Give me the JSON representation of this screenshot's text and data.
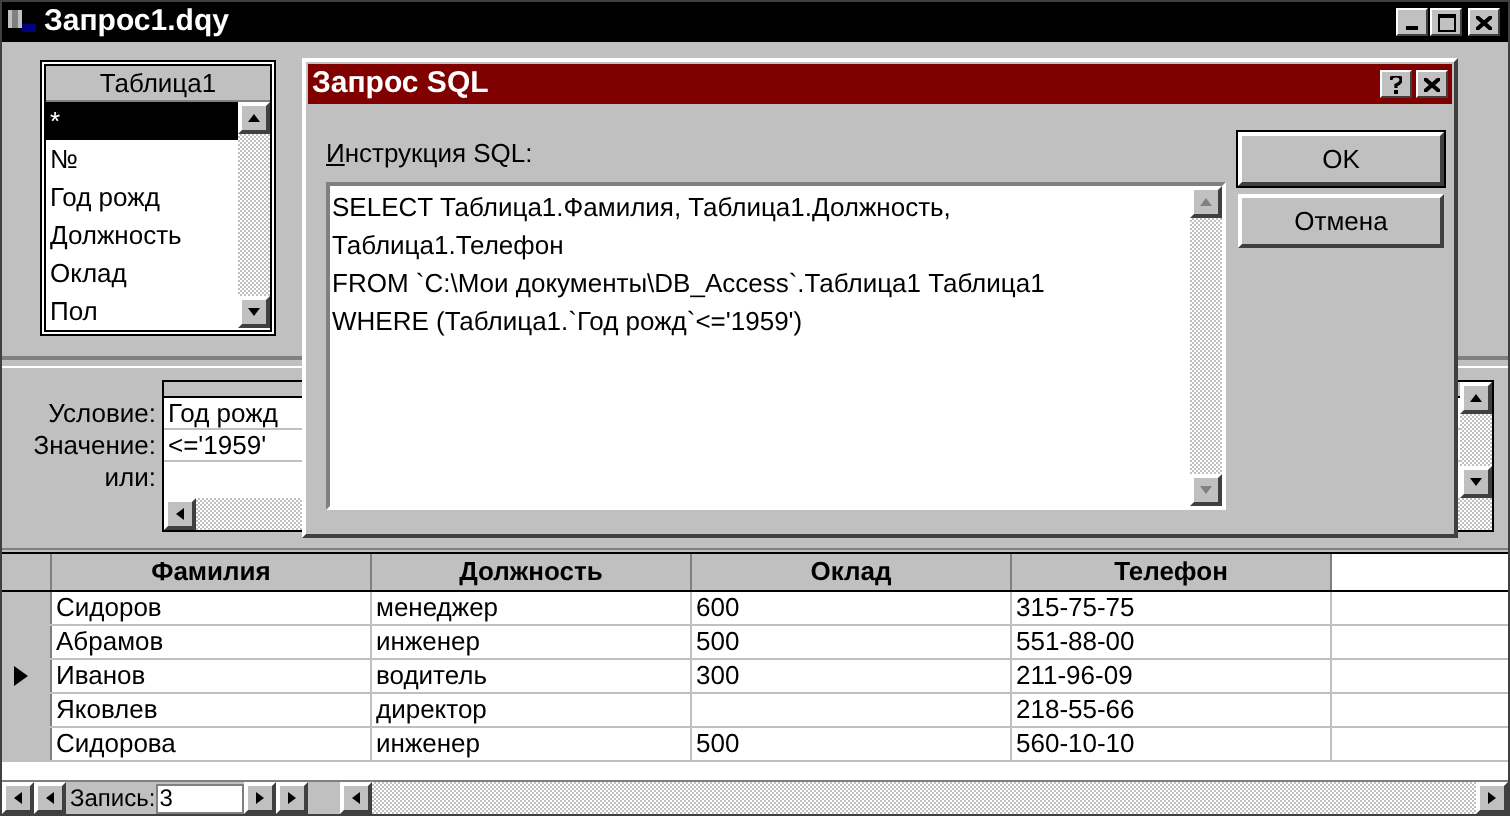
{
  "window": {
    "title": "Запрос1.dqy"
  },
  "table_list": {
    "title": "Таблица1",
    "fields": [
      {
        "label": "*",
        "selected": true
      },
      {
        "label": "№",
        "selected": false
      },
      {
        "label": "Год рожд",
        "selected": false
      },
      {
        "label": "Должность",
        "selected": false
      },
      {
        "label": "Оклад",
        "selected": false
      },
      {
        "label": "Пол",
        "selected": false
      }
    ]
  },
  "criteria": {
    "labels": [
      "Условие:",
      "Значение:",
      "или:"
    ],
    "field": "Год рожд",
    "value": "<='1959'"
  },
  "dialog": {
    "title": "Запрос SQL",
    "label": "Инструкция SQL:",
    "sql_lines": [
      "SELECT Таблица1.Фамилия, Таблица1.Должность,",
      "Таблица1.Телефон",
      "FROM `C:\\Мои документы\\DB_Access`.Таблица1 Таблица1",
      "WHERE (Таблица1.`Год рожд`<='1959')"
    ],
    "buttons": [
      {
        "label": "OK",
        "default": true
      },
      {
        "label": "Отмена",
        "default": false
      }
    ]
  },
  "results": {
    "columns": [
      "Фамилия",
      "Должность",
      "Оклад",
      "Телефон"
    ],
    "rows": [
      {
        "current": false,
        "cells": [
          "Сидоров",
          "менеджер",
          "600",
          "315-75-75"
        ]
      },
      {
        "current": false,
        "cells": [
          "Абрамов",
          "инженер",
          "500",
          "551-88-00"
        ]
      },
      {
        "current": true,
        "cells": [
          "Иванов",
          "водитель",
          "300",
          "211-96-09"
        ]
      },
      {
        "current": false,
        "cells": [
          "Яковлев",
          "директор",
          "",
          "218-55-66"
        ]
      },
      {
        "current": false,
        "cells": [
          "Сидорова",
          "инженер",
          "500",
          "560-10-10"
        ]
      }
    ]
  },
  "record_nav": {
    "label": "Запись:",
    "value": "3"
  }
}
